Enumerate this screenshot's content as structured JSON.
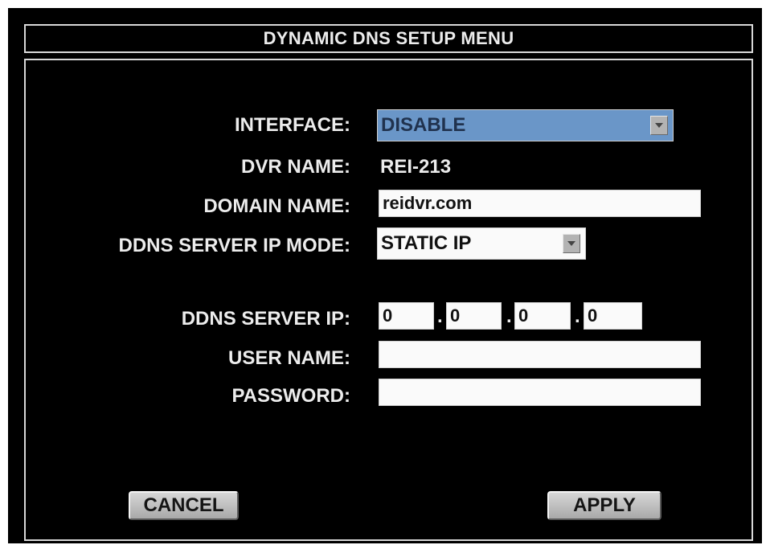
{
  "title": "DYNAMIC DNS SETUP MENU",
  "interface": {
    "label": "INTERFACE:",
    "value": "DISABLE"
  },
  "dvr_name": {
    "label": "DVR NAME:",
    "value": "REI-213"
  },
  "domain_name": {
    "label": "DOMAIN NAME:",
    "value": "reidvr.com"
  },
  "ip_mode": {
    "label": "DDNS SERVER IP MODE:",
    "value": "STATIC IP"
  },
  "server_ip": {
    "label": "DDNS SERVER IP:",
    "octets": [
      "0",
      "0",
      "0",
      "0"
    ],
    "separator": "."
  },
  "user_name": {
    "label": "USER NAME:",
    "value": ""
  },
  "password": {
    "label": "PASSWORD:",
    "value": ""
  },
  "buttons": {
    "cancel": "CANCEL",
    "apply": "APPLY"
  },
  "colors": {
    "selected_highlight": "#6a96c8",
    "background": "#000000",
    "text": "#ececec"
  }
}
